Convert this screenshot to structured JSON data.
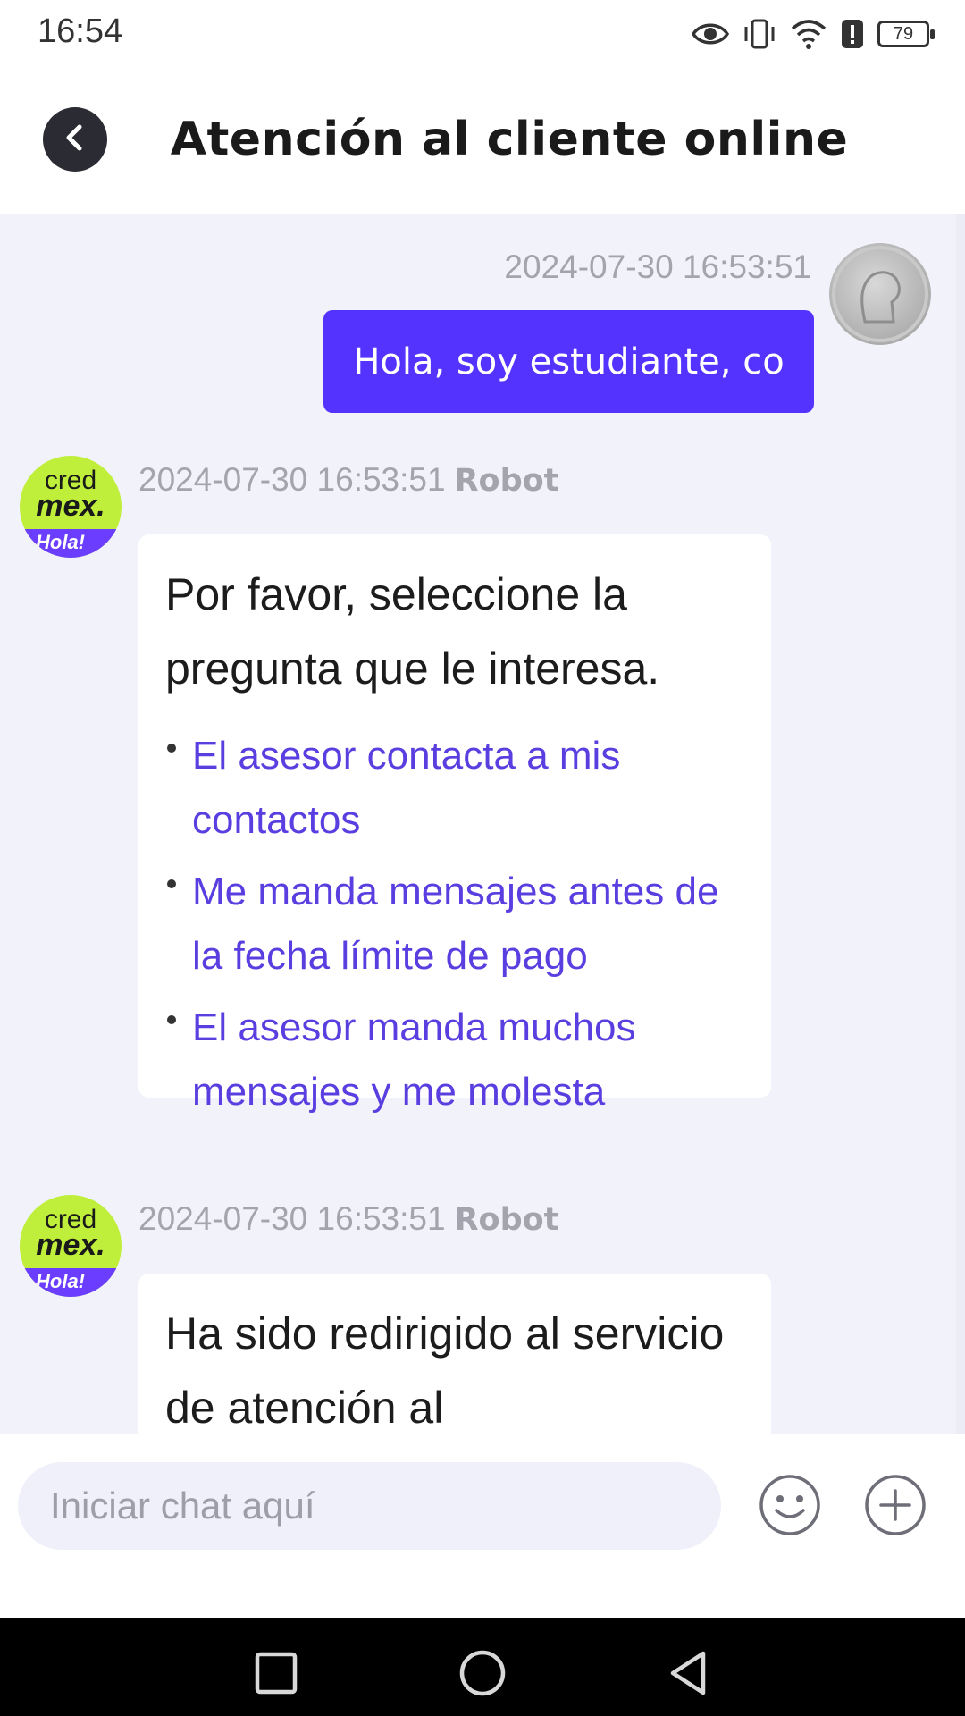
{
  "status_bar": {
    "time": "16:54",
    "battery": "79",
    "icons": [
      "eye-icon",
      "vibrate-icon",
      "wifi-icon",
      "alert-icon",
      "battery-icon"
    ]
  },
  "header": {
    "title": "Atención al cliente online",
    "back_icon": "chevron-left-icon"
  },
  "messages": [
    {
      "from": "user",
      "timestamp": "2024-07-30 16:53:51",
      "text": "Hola, soy estudiante, co"
    },
    {
      "from": "bot",
      "timestamp": "2024-07-30 16:53:51",
      "sender": "Robot",
      "text": "Por favor, seleccione la pregunta que le interesa.",
      "options": [
        "El asesor contacta a mis contactos",
        "Me manda mensajes antes de la fecha límite de pago",
        "El asesor manda muchos mensajes y me molesta"
      ]
    },
    {
      "from": "bot",
      "timestamp": "2024-07-30 16:53:51",
      "sender": "Robot",
      "text": "Ha sido redirigido al servicio de atención al"
    }
  ],
  "bot_logo": {
    "line1": "cred",
    "line2": "mex.",
    "badge": "Hola!"
  },
  "input_bar": {
    "placeholder": "Iniciar chat aquí",
    "emoji_icon": "smiley-icon",
    "plus_icon": "plus-icon"
  },
  "nav_bar": {
    "icons": [
      "square-icon",
      "circle-icon",
      "triangle-back-icon"
    ]
  },
  "colors": {
    "accent": "#5533ff",
    "link": "#5a3ee0",
    "bot_avatar": "#bfef3b",
    "chat_bg": "#f2f2fb"
  }
}
